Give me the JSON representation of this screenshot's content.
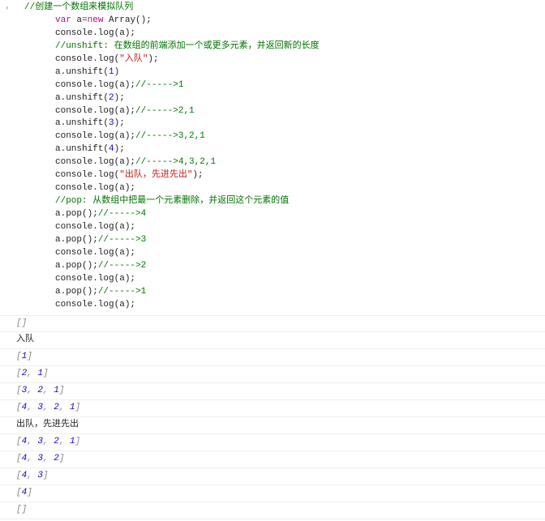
{
  "code": {
    "l1": "//创建一个数组来模拟队列",
    "l2a": "var",
    "l2b": " a=",
    "l2c": "new",
    "l2d": " Array();",
    "l3": "console.log(a);",
    "l4": "//unshift: 在数组的前端添加一个或更多元素，并返回新的长度",
    "l5a": "console.log(",
    "l5b": "\"入队\"",
    "l5c": ");",
    "l6a": "a.unshift(",
    "l6n": "1",
    "l6b": ")",
    "l7a": "console.log(a);",
    "l7c": "//----->1",
    "l8a": "a.unshift(",
    "l8n": "2",
    "l8b": ");",
    "l9a": "console.log(a);",
    "l9c": "//----->2,1",
    "l10a": "a.unshift(",
    "l10n": "3",
    "l10b": ");",
    "l11a": "console.log(a);",
    "l11c": "//----->3,2,1",
    "l12a": "a.unshift(",
    "l12n": "4",
    "l12b": ");",
    "l13a": "console.log(a);",
    "l13c": "//----->4,3,2,1",
    "l14a": "console.log(",
    "l14b": "\"出队，先进先出\"",
    "l14c": ");",
    "l15": "console.log(a);",
    "l16": "//pop: 从数组中把最一个元素删除，并返回这个元素的值",
    "l17a": "a.pop();",
    "l17c": "//----->4",
    "l18": "console.log(a);",
    "l19a": "a.pop();",
    "l19c": "//----->3",
    "l20": "console.log(a);",
    "l21a": "a.pop();",
    "l21c": "//----->2",
    "l22": "console.log(a);",
    "l23a": "a.pop();",
    "l23c": "//----->1",
    "l24": "console.log(a);"
  },
  "output": {
    "o1": "[]",
    "o2": "入队",
    "o3": {
      "open": "[",
      "vals": [
        "1"
      ],
      "close": "]"
    },
    "o4": {
      "open": "[",
      "vals": [
        "2",
        "1"
      ],
      "close": "]"
    },
    "o5": {
      "open": "[",
      "vals": [
        "3",
        "2",
        "1"
      ],
      "close": "]"
    },
    "o6": {
      "open": "[",
      "vals": [
        "4",
        "3",
        "2",
        "1"
      ],
      "close": "]"
    },
    "o7": "出队，先进先出",
    "o8": {
      "open": "[",
      "vals": [
        "4",
        "3",
        "2",
        "1"
      ],
      "close": "]"
    },
    "o9": {
      "open": "[",
      "vals": [
        "4",
        "3",
        "2"
      ],
      "close": "]"
    },
    "o10": {
      "open": "[",
      "vals": [
        "4",
        "3"
      ],
      "close": "]"
    },
    "o11": {
      "open": "[",
      "vals": [
        "4"
      ],
      "close": "]"
    },
    "o12": "[]"
  }
}
